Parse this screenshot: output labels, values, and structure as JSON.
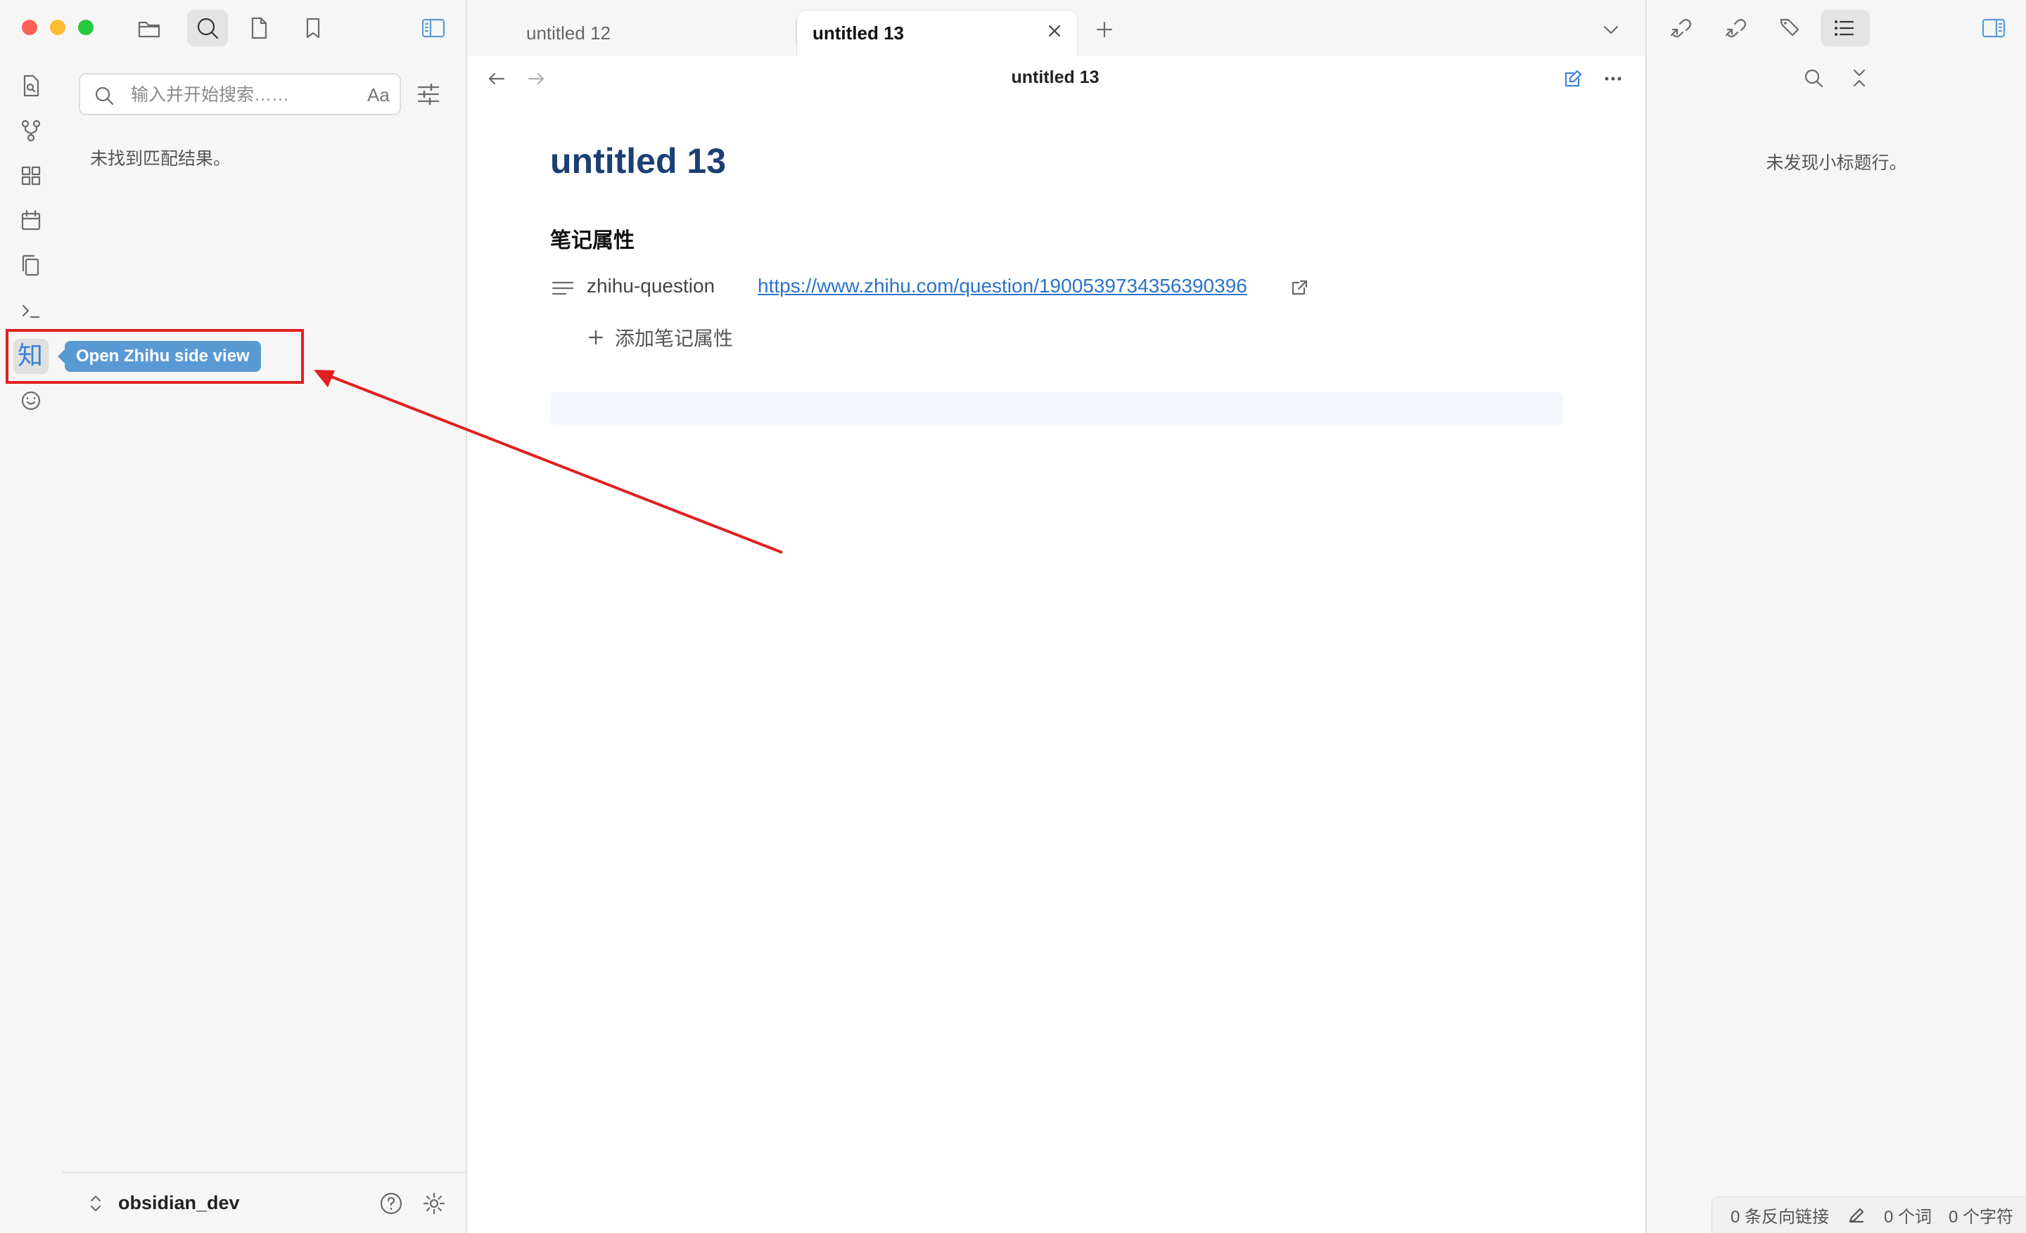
{
  "tabs": [
    {
      "label": "untitled 12",
      "active": false
    },
    {
      "label": "untitled 13",
      "active": true
    }
  ],
  "search": {
    "placeholder": "输入并开始搜索……",
    "case_toggle_label": "Aa",
    "no_results": "未找到匹配结果。"
  },
  "ribbon": {
    "zhihu_label": "知",
    "tooltip": "Open Zhihu side view"
  },
  "vault": {
    "name": "obsidian_dev"
  },
  "note": {
    "header_title": "untitled 13",
    "title": "untitled 13",
    "properties_heading": "笔记属性",
    "properties": [
      {
        "key": "zhihu-question",
        "value": "https://www.zhihu.com/question/1900539734356390396"
      }
    ],
    "add_property_label": "添加笔记属性"
  },
  "outline": {
    "empty_text": "未发现小标题行。"
  },
  "status_bar": {
    "backlinks": "0 条反向链接",
    "words": "0 个词",
    "chars": "0 个字符"
  },
  "colors": {
    "accent": "#5a9ad4",
    "title": "#1b3f73",
    "link": "#2a73c8",
    "annotation": "#e02020"
  }
}
